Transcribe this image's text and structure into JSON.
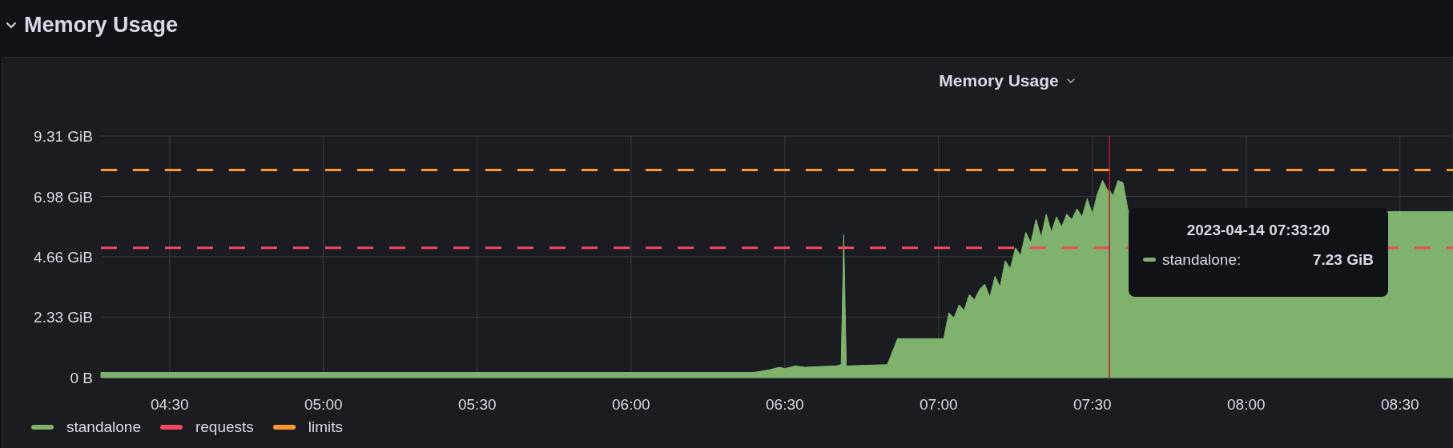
{
  "section": {
    "title": "Memory Usage",
    "expanded": true
  },
  "panel": {
    "title": "Memory Usage",
    "chart_data": {
      "type": "area",
      "grid": true,
      "x": [
        256.6,
        384,
        387,
        389,
        390,
        392,
        394,
        396,
        400,
        401,
        401.5,
        402,
        410,
        412,
        421,
        422,
        423,
        424,
        425,
        426,
        427,
        428,
        429,
        430,
        431,
        432,
        433,
        434,
        435,
        436,
        437,
        438,
        439,
        440,
        441,
        442,
        443,
        444,
        445,
        446,
        447,
        448,
        449,
        450,
        451,
        452,
        453,
        453.33,
        454,
        455,
        456,
        457,
        458,
        460,
        470,
        500,
        520.5
      ],
      "series": [
        {
          "name": "standalone",
          "color": "#7eb26d",
          "values": [
            0.2,
            0.2,
            0.3,
            0.4,
            0.35,
            0.45,
            0.4,
            0.42,
            0.45,
            0.5,
            5.5,
            0.45,
            0.5,
            1.5,
            1.5,
            2.5,
            2.3,
            2.8,
            2.6,
            3.2,
            3.0,
            3.4,
            3.6,
            3.1,
            3.9,
            3.5,
            4.5,
            4.2,
            5.0,
            4.7,
            5.6,
            5.2,
            6.1,
            5.4,
            6.3,
            5.6,
            6.2,
            5.8,
            6.3,
            6.1,
            6.5,
            6.2,
            6.9,
            6.3,
            7.1,
            7.6,
            7.2,
            7.23,
            7.0,
            7.6,
            7.5,
            6.4,
            null,
            null,
            null,
            null,
            6.4
          ]
        }
      ],
      "ref_lines": [
        {
          "axis": "y",
          "value": 5,
          "label": "requests",
          "color": "#f2495c"
        },
        {
          "axis": "y",
          "value": 8,
          "label": "limits",
          "color": "#ff9830"
        },
        {
          "axis": "x",
          "value": 453.33,
          "color": "#c4162a"
        }
      ],
      "xlim": [
        256.6,
        520.5
      ],
      "ylim": [
        0,
        9.31
      ],
      "xticks": [
        {
          "value": 270,
          "label": "04:30"
        },
        {
          "value": 300,
          "label": "05:00"
        },
        {
          "value": 330,
          "label": "05:30"
        },
        {
          "value": 360,
          "label": "06:00"
        },
        {
          "value": 390,
          "label": "06:30"
        },
        {
          "value": 420,
          "label": "07:00"
        },
        {
          "value": 450,
          "label": "07:30"
        },
        {
          "value": 480,
          "label": "08:00"
        },
        {
          "value": 510,
          "label": "08:30"
        }
      ],
      "yticks": [
        {
          "value": 0,
          "label": "0 B"
        },
        {
          "value": 2.33,
          "label": "2.33 GiB"
        },
        {
          "value": 4.66,
          "label": "4.66 GiB"
        },
        {
          "value": 6.98,
          "label": "6.98 GiB"
        },
        {
          "value": 9.31,
          "label": "9.31 GiB"
        }
      ]
    },
    "tooltip": {
      "time": "2023-04-14 07:33:20",
      "series": "standalone:",
      "value": "7.23 GiB",
      "color": "#7eb26d"
    }
  }
}
